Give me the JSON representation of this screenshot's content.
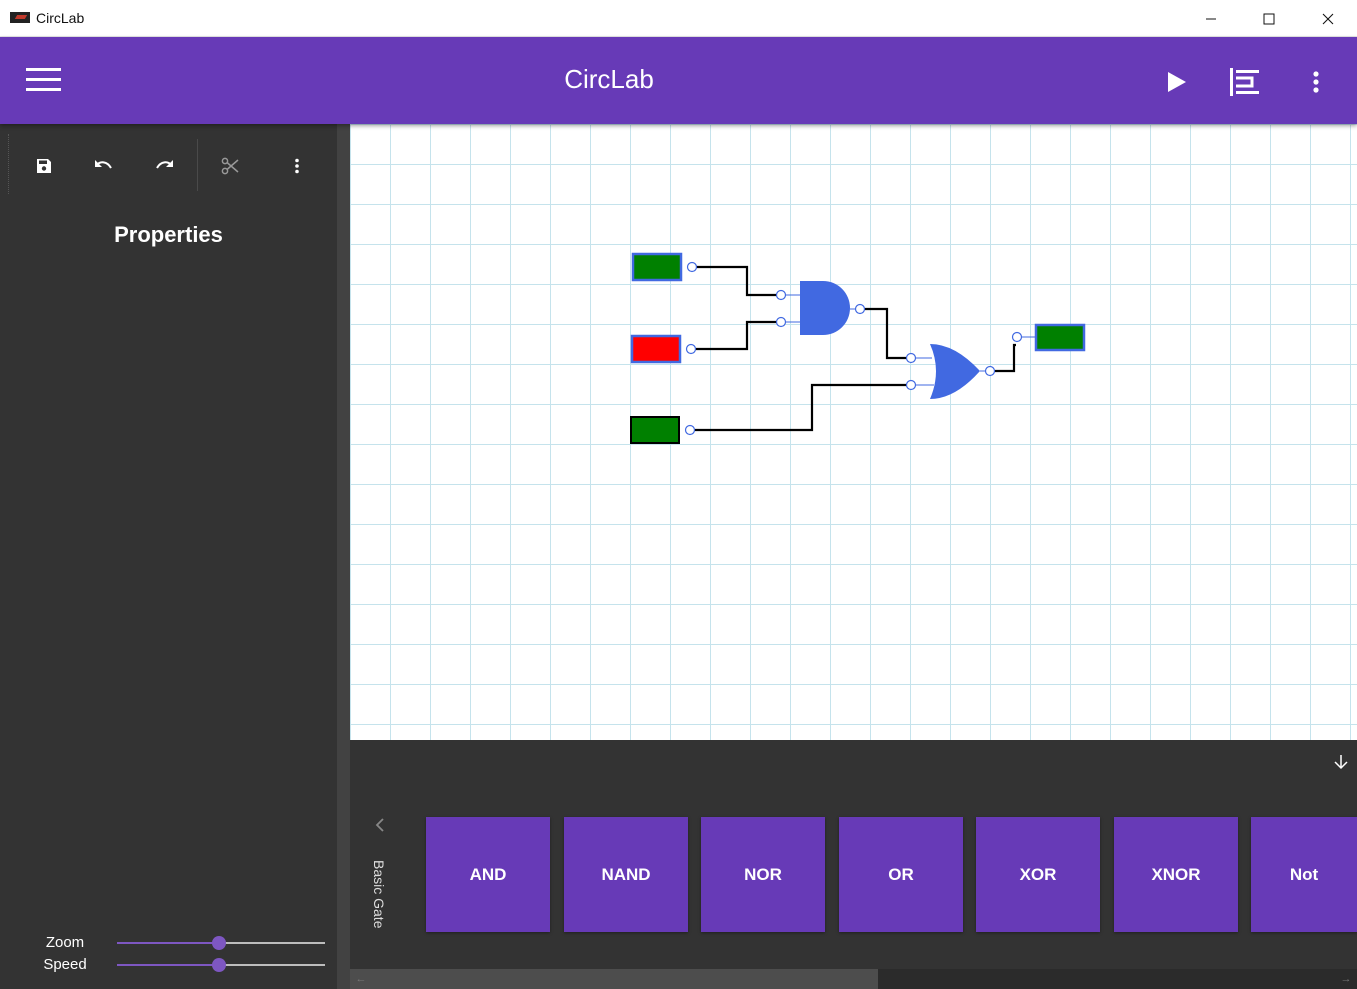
{
  "window": {
    "title": "CircLab"
  },
  "appbar": {
    "title": "CircLab",
    "color": "#673ab7",
    "icons": [
      "menu-icon",
      "play-icon",
      "align-icon",
      "more-vert-icon"
    ]
  },
  "sidebar": {
    "toolbar_icons": [
      "save-icon",
      "undo-icon",
      "redo-icon",
      "cut-icon",
      "more-vert-icon"
    ],
    "properties_title": "Properties",
    "zoom": {
      "label": "Zoom",
      "value": 0.49
    },
    "speed": {
      "label": "Speed",
      "value": 0.49
    }
  },
  "circuit": {
    "inputs": [
      {
        "state": "on",
        "color": "#008000"
      },
      {
        "state": "off",
        "color": "#ff0000"
      },
      {
        "state": "on",
        "color": "#008000"
      }
    ],
    "gates": [
      {
        "type": "AND",
        "color": "#4169e1"
      },
      {
        "type": "OR",
        "color": "#4169e1"
      }
    ],
    "outputs": [
      {
        "state": "on",
        "color": "#008000"
      }
    ]
  },
  "palette": {
    "category": "Basic Gate",
    "gates": [
      "AND",
      "NAND",
      "NOR",
      "OR",
      "XOR",
      "XNOR",
      "Not"
    ]
  }
}
